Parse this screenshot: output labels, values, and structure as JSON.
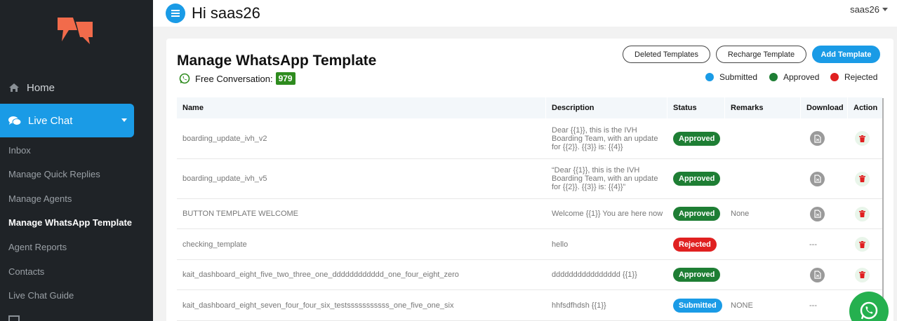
{
  "sidebar": {
    "home_label": "Home",
    "live_chat_label": "Live Chat",
    "sub_items": [
      {
        "label": "Inbox",
        "active": false
      },
      {
        "label": "Manage Quick Replies",
        "active": false
      },
      {
        "label": "Manage Agents",
        "active": false
      },
      {
        "label": "Manage WhatsApp Template",
        "active": true
      },
      {
        "label": "Agent Reports",
        "active": false
      },
      {
        "label": "Contacts",
        "active": false
      },
      {
        "label": "Live Chat Guide",
        "active": false
      }
    ]
  },
  "header": {
    "greeting": "Hi saas26",
    "user_name": "saas26"
  },
  "page": {
    "title": "Manage WhatsApp Template",
    "free_conversation_label": "Free Conversation:",
    "free_conversation_count": "979",
    "buttons": {
      "deleted": "Deleted Templates",
      "recharge": "Recharge Template",
      "add": "Add Template"
    },
    "legend": [
      {
        "label": "Submitted",
        "color": "#1a9be6"
      },
      {
        "label": "Approved",
        "color": "#1e7e34"
      },
      {
        "label": "Rejected",
        "color": "#e02020"
      }
    ]
  },
  "table": {
    "headers": [
      "Name",
      "Description",
      "Status",
      "Remarks",
      "Download",
      "Action"
    ],
    "rows": [
      {
        "name": "boarding_update_ivh_v2",
        "description": "Dear {{1}}, this is the IVH Boarding Team, with an update for {{2}}. {{3}} is: {{4}}",
        "status": "Approved",
        "remarks": "",
        "download": "icon"
      },
      {
        "name": "boarding_update_ivh_v5",
        "description": "“Dear {{1}}, this is the IVH Boarding Team, with an update for {{2}}. {{3}} is: {{4}}”",
        "status": "Approved",
        "remarks": "",
        "download": "icon"
      },
      {
        "name": "BUTTON TEMPLATE WELCOME",
        "description": "Welcome {{1}} You are here now",
        "status": "Approved",
        "remarks": "None",
        "download": "icon"
      },
      {
        "name": "checking_template",
        "description": "hello",
        "status": "Rejected",
        "remarks": "",
        "download": "---"
      },
      {
        "name": "kait_dashboard_eight_five_two_three_one_dddddddddddd_one_four_eight_zero",
        "description": "dddddddddddddddd {{1}}",
        "status": "Approved",
        "remarks": "",
        "download": "icon"
      },
      {
        "name": "kait_dashboard_eight_seven_four_four_six_testsssssssssss_one_five_one_six",
        "description": "hhfsdfhdsh {{1}}",
        "status": "Submitted",
        "remarks": "NONE",
        "download": "---"
      }
    ]
  },
  "colors": {
    "sidebar_bg": "#1f2327",
    "accent": "#1a9be6",
    "approved": "#1e7e34",
    "rejected": "#e02020",
    "submitted": "#1a9be6",
    "logo": "#f26b4b",
    "whatsapp": "#25b04f"
  }
}
